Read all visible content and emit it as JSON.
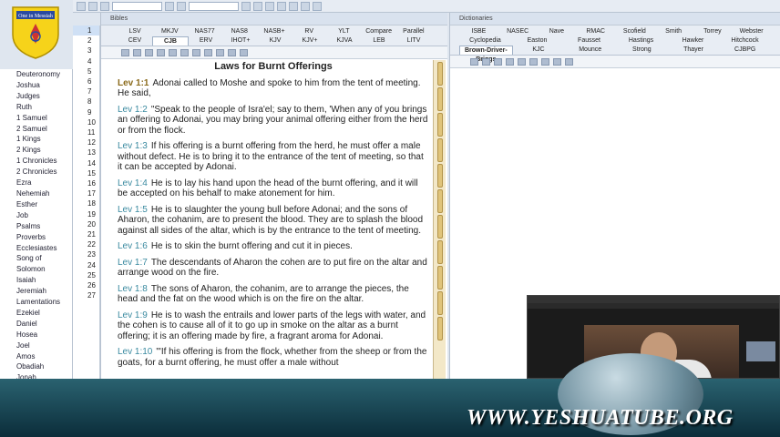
{
  "logo_text": "One in Messiah",
  "panels": {
    "bibles": "Bibles",
    "dictionaries": "Dictionaries"
  },
  "books": [
    "Deuteronomy",
    "Joshua",
    "Judges",
    "Ruth",
    "1 Samuel",
    "2 Samuel",
    "1 Kings",
    "2 Kings",
    "1 Chronicles",
    "2 Chronicles",
    "Ezra",
    "Nehemiah",
    "Esther",
    "Job",
    "Psalms",
    "Proverbs",
    "Ecclesiastes",
    "Song of Solomon",
    "Isaiah",
    "Jeremiah",
    "Lamentations",
    "Ezekiel",
    "Daniel",
    "Hosea",
    "Joel",
    "Amos",
    "Obadiah",
    "Jonah"
  ],
  "chapters": [
    "1",
    "2",
    "3",
    "4",
    "5",
    "6",
    "7",
    "8",
    "9",
    "10",
    "11",
    "12",
    "13",
    "14",
    "15",
    "16",
    "17",
    "18",
    "19",
    "20",
    "21",
    "22",
    "23",
    "24",
    "25",
    "26",
    "27"
  ],
  "bible_tabs_row1": [
    "LSV",
    "MKJV",
    "NAS77",
    "NAS8",
    "NASB+",
    "RV",
    "YLT",
    "Compare",
    "Parallel"
  ],
  "bible_tabs_row2": [
    "CEV",
    "CJB",
    "ERV",
    "IHOT+",
    "KJV",
    "KJV+",
    "KJVA",
    "LEB",
    "LITV"
  ],
  "active_bible": "CJB",
  "passage_title": "Laws for Burnt Offerings",
  "verses": [
    {
      "ref": "Lev 1:1",
      "text": "Adonai called to Moshe and spoke to him from the tent of meeting. He said,"
    },
    {
      "ref": "Lev 1:2",
      "text": "\"Speak to the people of Isra'el; say to them, 'When any of you brings an offering to Adonai, you may bring your animal offering either from the herd or from the flock."
    },
    {
      "ref": "Lev 1:3",
      "text": "If his offering is a burnt offering from the herd, he must offer a male without defect. He is to bring it to the entrance of the tent of meeting, so that it can be accepted by Adonai."
    },
    {
      "ref": "Lev 1:4",
      "text": "He is to lay his hand upon the head of the burnt offering, and it will be accepted on his behalf to make atonement for him."
    },
    {
      "ref": "Lev 1:5",
      "text": "He is to slaughter the young bull before Adonai; and the sons of Aharon, the cohanim, are to present the blood. They are to splash the blood against all sides of the altar, which is by the entrance to the tent of meeting."
    },
    {
      "ref": "Lev 1:6",
      "text": "He is to skin the burnt offering and cut it in pieces."
    },
    {
      "ref": "Lev 1:7",
      "text": "The descendants of Aharon the cohen are to put fire on the altar and arrange wood on the fire."
    },
    {
      "ref": "Lev 1:8",
      "text": "The sons of Aharon, the cohanim, are to arrange the pieces, the head and the fat on the wood which is on the fire on the altar."
    },
    {
      "ref": "Lev 1:9",
      "text": "He is to wash the entrails and lower parts of the legs with water, and the cohen is to cause all of it to go up in smoke on the altar as a burnt offering; it is an offering made by fire, a fragrant aroma for Adonai."
    },
    {
      "ref": "Lev 1:10",
      "text": "\"'If his offering is from the flock, whether from the sheep or from the goats, for a burnt offering, he must offer a male without"
    }
  ],
  "dict_tabs_row1": [
    "ISBE",
    "NASEC",
    "Nave",
    "RMAC",
    "Scofield",
    "Smith",
    "Torrey",
    "Webster"
  ],
  "dict_tabs_row2": [
    "Cyclopedia",
    "Easton",
    "Fausset",
    "Hastings",
    "Hawker",
    "Hitchcock"
  ],
  "dict_tabs_row3": [
    "Brown-Driver-Briggs",
    "KJC",
    "Mounce",
    "Strong",
    "Thayer",
    "CJBPG"
  ],
  "active_dict": "Brown-Driver-Briggs",
  "footer": "WWW.YESHUATUBE.ORG",
  "colors": {
    "ref": "#3a8aa0",
    "accent": "#cfe0f5",
    "footer_bg": "#0b2d3a"
  }
}
